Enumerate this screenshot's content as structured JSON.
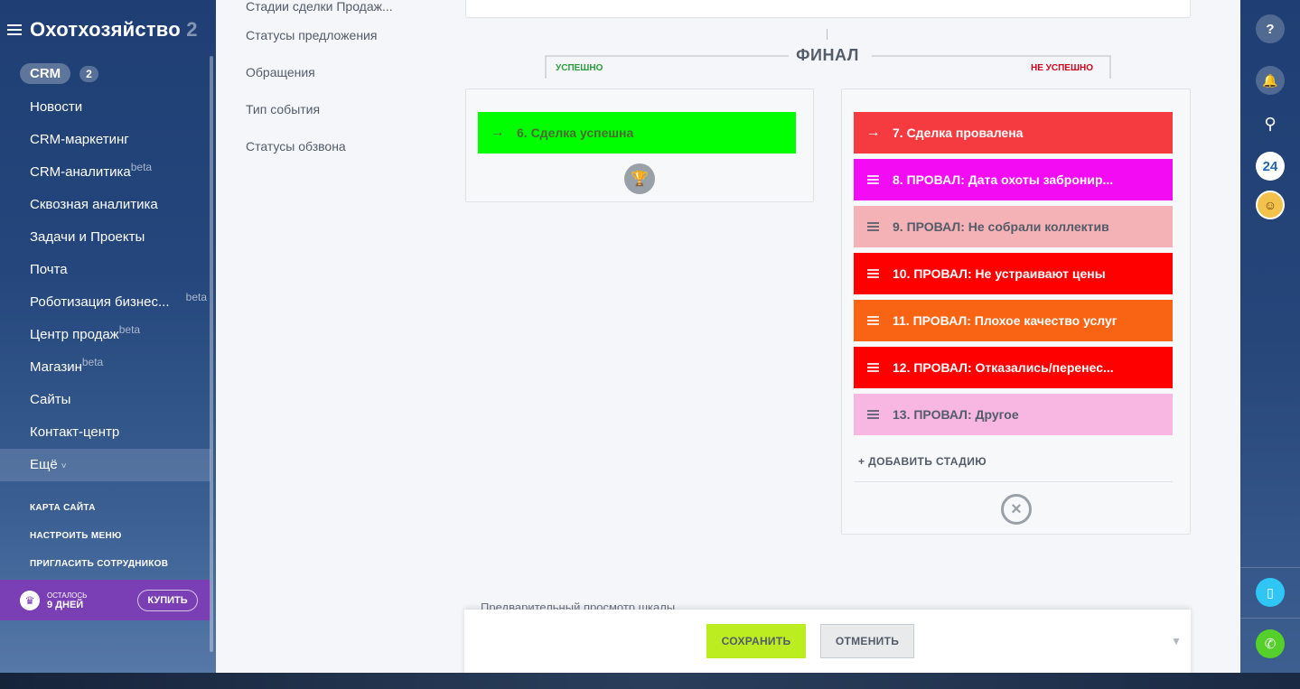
{
  "sidebar": {
    "portal_title": "Охотхозяйство",
    "portal_title_fade": " 2",
    "crm_label": "CRM",
    "crm_count": "2",
    "items": [
      {
        "label": "Новости",
        "beta": ""
      },
      {
        "label": "CRM-маркетинг",
        "beta": ""
      },
      {
        "label": "CRM-аналитика",
        "beta": "beta"
      },
      {
        "label": "Сквозная аналитика",
        "beta": ""
      },
      {
        "label": "Задачи и Проекты",
        "beta": ""
      },
      {
        "label": "Почта",
        "beta": ""
      },
      {
        "label": "Роботизация бизнес...",
        "beta": "beta"
      },
      {
        "label": "Центр продаж",
        "beta": "beta"
      },
      {
        "label": "Магазин",
        "beta": "beta"
      },
      {
        "label": "Сайты",
        "beta": ""
      },
      {
        "label": "Контакт-центр",
        "beta": ""
      },
      {
        "label": "Ещё",
        "beta": ""
      }
    ],
    "links": [
      "КАРТА САЙТА",
      "НАСТРОИТЬ МЕНЮ",
      "ПРИГЛАСИТЬ СОТРУДНИКОВ"
    ],
    "trial": {
      "line1": "ОСТАЛОСЬ",
      "line2": "9 ДНЕЙ",
      "buy_label": "КУПИТЬ"
    }
  },
  "submenu": [
    "Стадии сделки Продаж...",
    "Статусы предложения",
    "Обращения",
    "Тип события",
    "Статусы обзвона"
  ],
  "final": {
    "title": "ФИНАЛ",
    "success_label": "УСПЕШНО",
    "fail_label": "НЕ УСПЕШНО",
    "success_stage": {
      "label": "6. Сделка успешна",
      "color": "#00ff00"
    },
    "fail_stages": [
      {
        "label": "7. Сделка провалена",
        "color": "#f53b3f",
        "text_color": "#ffffff"
      },
      {
        "label": "8. ПРОВАЛ: Дата охоты забронир...",
        "color": "#f30bf3",
        "text_color": "#ffffff"
      },
      {
        "label": "9. ПРОВАЛ: Не собрали коллектив",
        "color": "#f5b2b6",
        "text_color": "#535c69"
      },
      {
        "label": "10. ПРОВАЛ: Не устраивают цены",
        "color": "#ff0000",
        "text_color": "#ffffff"
      },
      {
        "label": "11. ПРОВАЛ: Плохое качество услуг",
        "color": "#f86414",
        "text_color": "#ffffff"
      },
      {
        "label": "12. ПРОВАЛ: Отказались/перенес...",
        "color": "#ff0000",
        "text_color": "#ffffff"
      },
      {
        "label": "13. ПРОВАЛ: Другое",
        "color": "#f7b7e2",
        "text_color": "#535c69"
      }
    ],
    "add_stage_label": "+ ДОБАВИТЬ СТАДИЮ"
  },
  "preview_label": "Предварительный просмотр шкалы",
  "buttons": {
    "save": "СОХРАНИТЬ",
    "cancel": "ОТМЕНИТЬ"
  },
  "rail": {
    "help": "?",
    "b24": "24"
  }
}
